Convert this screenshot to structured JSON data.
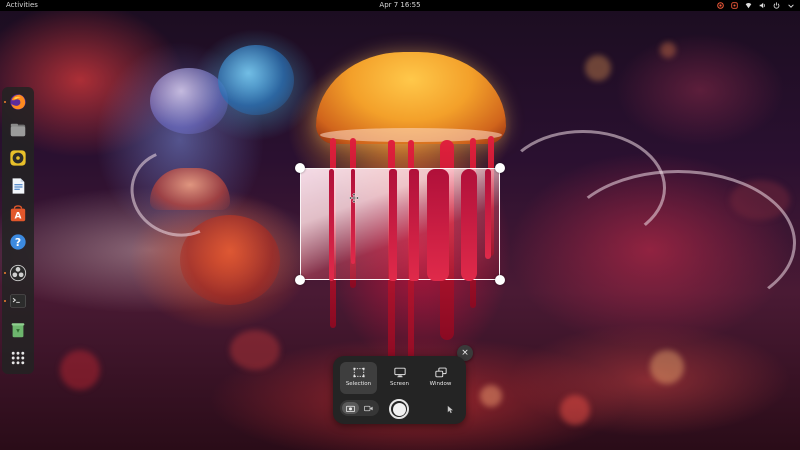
{
  "topbar": {
    "activities_label": "Activities",
    "clock": "Apr 7  16:55",
    "tray_icons": [
      "screen-recording-icon",
      "accessibility-icon",
      "network-icon",
      "volume-icon",
      "power-icon",
      "dropdown-icon"
    ]
  },
  "dock": {
    "items": [
      {
        "name": "firefox-icon"
      },
      {
        "name": "files-icon"
      },
      {
        "name": "rhythmbox-icon"
      },
      {
        "name": "writer-icon"
      },
      {
        "name": "software-icon"
      },
      {
        "name": "help-icon"
      },
      {
        "name": "obs-icon"
      },
      {
        "name": "terminal-icon"
      },
      {
        "name": "trash-icon"
      },
      {
        "name": "show-apps-icon"
      }
    ]
  },
  "screenshot_panel": {
    "modes": [
      {
        "label": "Selection",
        "icon": "selection-icon",
        "active": true
      },
      {
        "label": "Screen",
        "icon": "screen-icon",
        "active": false
      },
      {
        "label": "Window",
        "icon": "window-icon",
        "active": false
      }
    ],
    "capture_types": [
      {
        "icon": "camera-icon",
        "active": true
      },
      {
        "icon": "video-camera-icon",
        "active": false
      }
    ],
    "close_symbol": "×"
  },
  "colors": {
    "accent_orange": "#f08030",
    "panel_bg": "#242424",
    "topbar_bg": "#000000"
  }
}
